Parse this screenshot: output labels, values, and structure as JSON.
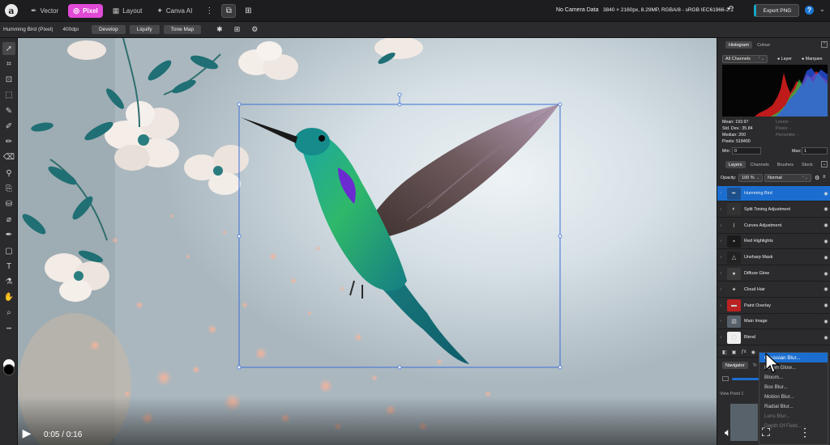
{
  "topbar": {
    "personas": [
      {
        "label": "Vector",
        "icon": "vector-persona-icon",
        "active": false
      },
      {
        "label": "Pixel",
        "icon": "pixel-persona-icon",
        "active": true
      },
      {
        "label": "Layout",
        "icon": "layout-persona-icon",
        "active": false
      },
      {
        "label": "Canva AI",
        "icon": "canva-ai-icon",
        "active": false
      }
    ],
    "camera_data": "No Camera Data",
    "doc_info": "3840 × 2160px, 8.29MP, RGBA/8 - sRGB IEC61966-2.1",
    "export_label": "Export PNG",
    "help_glyph": "?"
  },
  "context": {
    "layer_label": "Humming Bird (Pixel)",
    "dpi": "400dpi",
    "buttons": [
      "Develop",
      "Liquify",
      "Tone Map"
    ]
  },
  "tools": [
    "move-tool-icon",
    "crop-tool-icon",
    "vector-crop-icon",
    "marquee-tool-icon",
    "selection-brush-icon",
    "paint-brush-icon",
    "pixel-brush-icon",
    "erase-brush-icon",
    "dodge-brush-icon",
    "clone-brush-icon",
    "flood-fill-icon",
    "paint-mixer-icon",
    "pen-tool-icon",
    "rectangle-tool-icon",
    "text-tool-icon",
    "eyedropper-icon",
    "hand-tool-icon",
    "zoom-tool-icon"
  ],
  "colors": {
    "accent": "#e04ad6",
    "selection": "#1b6ed0",
    "export_accent": "#18a6c8",
    "panel": "#2b2b2d"
  },
  "histogram_panel": {
    "tabs": [
      "Histogram",
      "Colour"
    ],
    "channel": "All Channels",
    "options": [
      "Layer",
      "Marquee"
    ],
    "stats_left": [
      "Mean: 193.97",
      "Std. Dev.: 35.84",
      "Median: 200",
      "Pixels: 518400"
    ],
    "stats_right": [
      "Levels: -",
      "Pixels: -",
      "Percentile: -"
    ],
    "min_label": "Min:",
    "min_value": "0",
    "max_label": "Max:",
    "max_value": "1"
  },
  "layers_panel": {
    "tabs": [
      "Layers",
      "Channels",
      "Brushes",
      "Stock"
    ],
    "opacity_label": "Opacity:",
    "opacity_value": "100 %",
    "blend_mode": "Normal",
    "layers": [
      {
        "name": "Humming Bird",
        "selected": true
      },
      {
        "name": "Split Toning Adjustment",
        "selected": false
      },
      {
        "name": "Curves Adjustment",
        "selected": false
      },
      {
        "name": "Red Highlights",
        "selected": false
      },
      {
        "name": "Unsharp Mask",
        "selected": false
      },
      {
        "name": "Diffuse Glow",
        "selected": false
      },
      {
        "name": "Cloud Hair",
        "selected": false
      },
      {
        "name": "Paint Overlay",
        "selected": false
      },
      {
        "name": "Main Image",
        "selected": false
      },
      {
        "name": "Blend",
        "selected": false
      }
    ]
  },
  "navigator_panel": {
    "tabs": [
      "Navigator",
      "Tr"
    ],
    "view_label": "View Point 1"
  },
  "filter_menu": {
    "items": [
      "Gaussian Blur...",
      "Bokeh Glow...",
      "Bloom...",
      "Box Blur...",
      "Motion Blur...",
      "Radial Blur...",
      "Lens Blur...",
      "Depth Of Field..."
    ],
    "highlighted_index": 0
  },
  "video": {
    "time": "0:05 / 0:16",
    "controls": [
      "play-icon",
      "volume-icon",
      "fullscreen-icon",
      "more-icon"
    ]
  }
}
